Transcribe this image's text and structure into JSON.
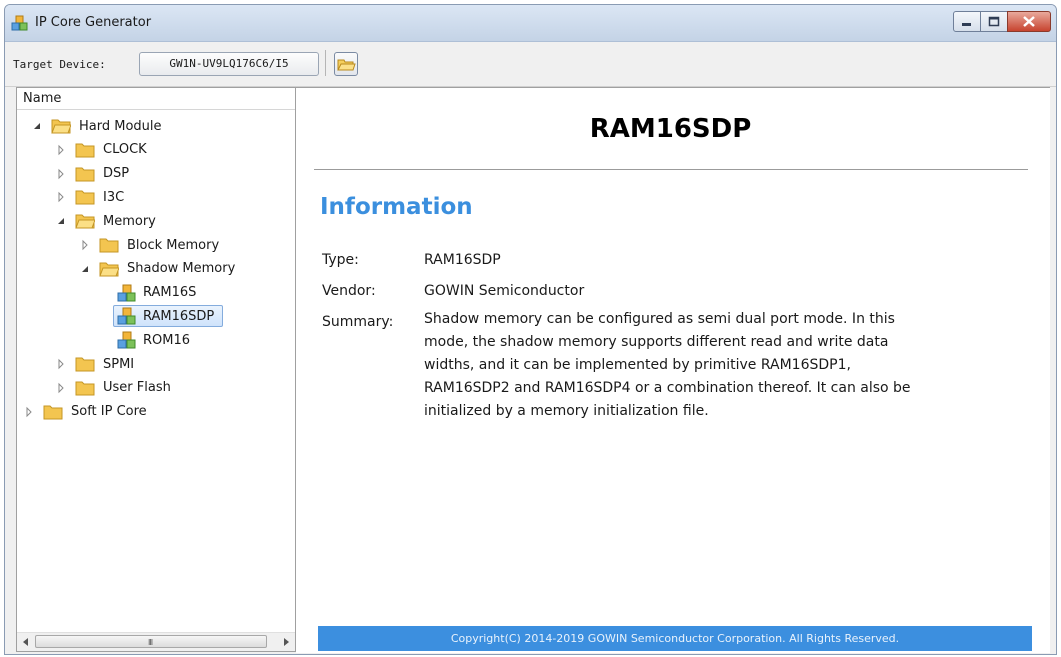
{
  "window": {
    "title": "IP Core Generator"
  },
  "toolbar": {
    "target_label": "Target Device:",
    "target_device": "GW1N-UV9LQ176C6/I5"
  },
  "tree": {
    "header": "Name",
    "nodes": [
      {
        "label": "Hard Module",
        "expanded": true,
        "kind": "folder"
      },
      {
        "label": "CLOCK",
        "expanded": false,
        "kind": "folder"
      },
      {
        "label": "DSP",
        "expanded": false,
        "kind": "folder"
      },
      {
        "label": "I3C",
        "expanded": false,
        "kind": "folder"
      },
      {
        "label": "Memory",
        "expanded": true,
        "kind": "folder"
      },
      {
        "label": "Block Memory",
        "expanded": false,
        "kind": "folder"
      },
      {
        "label": "Shadow Memory",
        "expanded": true,
        "kind": "folder"
      },
      {
        "label": "RAM16S",
        "kind": "ip"
      },
      {
        "label": "RAM16SDP",
        "kind": "ip",
        "selected": true
      },
      {
        "label": "ROM16",
        "kind": "ip"
      },
      {
        "label": "SPMI",
        "expanded": false,
        "kind": "folder"
      },
      {
        "label": "User Flash",
        "expanded": false,
        "kind": "folder"
      },
      {
        "label": "Soft IP Core",
        "expanded": false,
        "kind": "folder"
      }
    ]
  },
  "content": {
    "title": "RAM16SDP",
    "section": "Information",
    "type_label": "Type:",
    "type_value": "RAM16SDP",
    "vendor_label": "Vendor:",
    "vendor_value": "GOWIN Semiconductor",
    "summary_label": "Summary:",
    "summary_lines": [
      "Shadow memory can be configured as semi dual port mode. In this",
      "mode, the shadow memory supports different read and write data",
      "widths, and it can be implemented by primitive RAM16SDP1,",
      "RAM16SDP2 and RAM16SDP4 or a combination thereof. It can also be",
      "initialized by a memory initialization file."
    ],
    "footer": "Copyright(C) 2014-2019 GOWIN Semiconductor Corporation. All Rights Reserved."
  },
  "colors": {
    "accent": "#3b8fde",
    "footer_bg": "#3c8fdf",
    "selection_border": "#84acdd"
  }
}
